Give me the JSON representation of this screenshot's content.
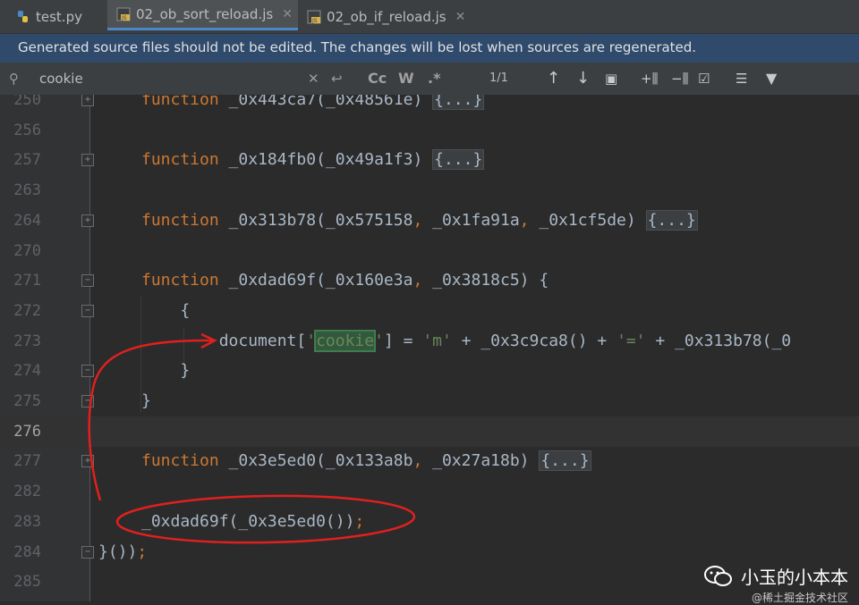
{
  "tabs": [
    {
      "label": "test.py",
      "icon": "python-file-icon",
      "active": false
    },
    {
      "label": "02_ob_sort_reload.js",
      "icon": "js-file-icon",
      "active": true
    },
    {
      "label": "02_ob_if_reload.js",
      "icon": "js-file-icon",
      "active": false
    }
  ],
  "banner": {
    "text": "Generated source files should not be edited. The changes will be lost when sources are regenerated."
  },
  "search": {
    "value": "cookie",
    "match_count": "1/1",
    "case_label": "Cc",
    "word_label": "W",
    "regex_label": ".*"
  },
  "lines": [
    {
      "num": "250",
      "tokens": [
        [
          "kw",
          "function"
        ],
        [
          "p",
          " _0x443ca7(_0x48561e) "
        ],
        [
          "fold",
          "{...}"
        ]
      ],
      "fold": "+"
    },
    {
      "num": "256",
      "tokens": []
    },
    {
      "num": "257",
      "tokens": [
        [
          "kw",
          "function"
        ],
        [
          "p",
          " _0x184fb0(_0x49a1f3) "
        ],
        [
          "fold",
          "{...}"
        ]
      ],
      "fold": "+"
    },
    {
      "num": "263",
      "tokens": []
    },
    {
      "num": "264",
      "tokens": [
        [
          "kw",
          "function"
        ],
        [
          "p",
          " _0x313b78(_0x575158"
        ],
        [
          "kw",
          ","
        ],
        [
          "p",
          " _0x1fa91a"
        ],
        [
          "kw",
          ","
        ],
        [
          "p",
          " _0x1cf5de) "
        ],
        [
          "fold",
          "{...}"
        ]
      ],
      "fold": "+"
    },
    {
      "num": "270",
      "tokens": []
    },
    {
      "num": "271",
      "tokens": [
        [
          "kw",
          "function"
        ],
        [
          "p",
          " _0xdad69f(_0x160e3a"
        ],
        [
          "kw",
          ","
        ],
        [
          "p",
          " _0x3818c5) {"
        ]
      ],
      "fold": "-"
    },
    {
      "num": "272",
      "tokens": [
        [
          "p",
          "    {"
        ]
      ],
      "fold": "-"
    },
    {
      "num": "273",
      "tokens": [
        [
          "p",
          "        document["
        ],
        [
          "str",
          "'"
        ],
        [
          "hl",
          "cookie"
        ],
        [
          "str",
          "'"
        ],
        [
          "p",
          "] = "
        ],
        [
          "str",
          "'m'"
        ],
        [
          "p",
          " + _0x3c9ca8() + "
        ],
        [
          "str",
          "'='"
        ],
        [
          "p",
          " + _0x313b78(_0"
        ]
      ]
    },
    {
      "num": "274",
      "tokens": [
        [
          "p",
          "    }"
        ]
      ],
      "fold": "-"
    },
    {
      "num": "275",
      "tokens": [
        [
          "p",
          "}"
        ]
      ],
      "fold": "-"
    },
    {
      "num": "276",
      "tokens": [],
      "current": true
    },
    {
      "num": "277",
      "tokens": [
        [
          "kw",
          "function"
        ],
        [
          "p",
          " _0x3e5ed0(_0x133a8b"
        ],
        [
          "kw",
          ","
        ],
        [
          "p",
          " _0x27a18b) "
        ],
        [
          "fold",
          "{...}"
        ]
      ],
      "fold": "+"
    },
    {
      "num": "282",
      "tokens": []
    },
    {
      "num": "283",
      "tokens": [
        [
          "p",
          "_0xdad69f(_0x3e5ed0())"
        ],
        [
          "kw",
          ";"
        ]
      ]
    },
    {
      "num": "284",
      "tokens": [
        [
          "p",
          "}())"
        ],
        [
          "kw",
          ";"
        ]
      ],
      "fold": "-",
      "outdent": true
    },
    {
      "num": "285",
      "tokens": []
    }
  ],
  "watermark": {
    "title": "小玉的小本本",
    "subtitle": "@稀土掘金技术社区"
  },
  "colors": {
    "keyword": "#cc7832",
    "string": "#6a8759",
    "text": "#a9b7c6",
    "annotation": "#e0201f",
    "banner": "#2f4a6b"
  }
}
